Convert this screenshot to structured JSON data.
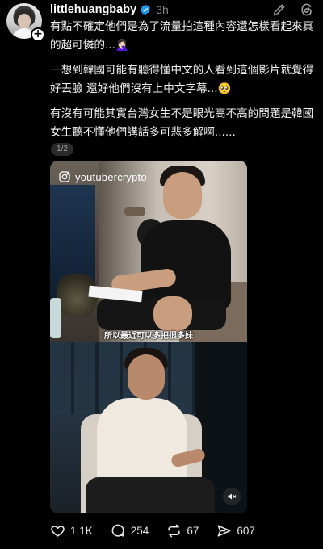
{
  "post": {
    "username": "littlehuangbaby",
    "time": "3h",
    "paragraphs": [
      "有點不確定他們是為了流量拍這種內容還怎樣看起來真的超可憐的...🤦🏻‍♀️",
      "一想到韓國可能有聽得懂中文的人看到這個影片就覺得好丟臉 還好他們沒有上中文字幕...🥺",
      "有沒有可能其實台灣女生不是眼光高不高的問題是韓國女生聽不懂他們講話多可悲多解啊......"
    ],
    "page_indicator": "1/2"
  },
  "media": {
    "ig_handle": "youtubercrypto",
    "subtitle": "所以最近可以多把很多妹"
  },
  "actions": {
    "likes": "1.1K",
    "comments": "254",
    "reposts": "67",
    "shares": "607"
  },
  "colors": {
    "background": "#000000",
    "verified": "#1d9bf0",
    "muted_text": "#8a8a8a"
  },
  "icons": [
    "edit-icon",
    "threads-logo-icon",
    "heart-icon",
    "comment-icon",
    "repost-icon",
    "share-icon",
    "mute-icon",
    "instagram-icon",
    "verified-badge-icon"
  ]
}
